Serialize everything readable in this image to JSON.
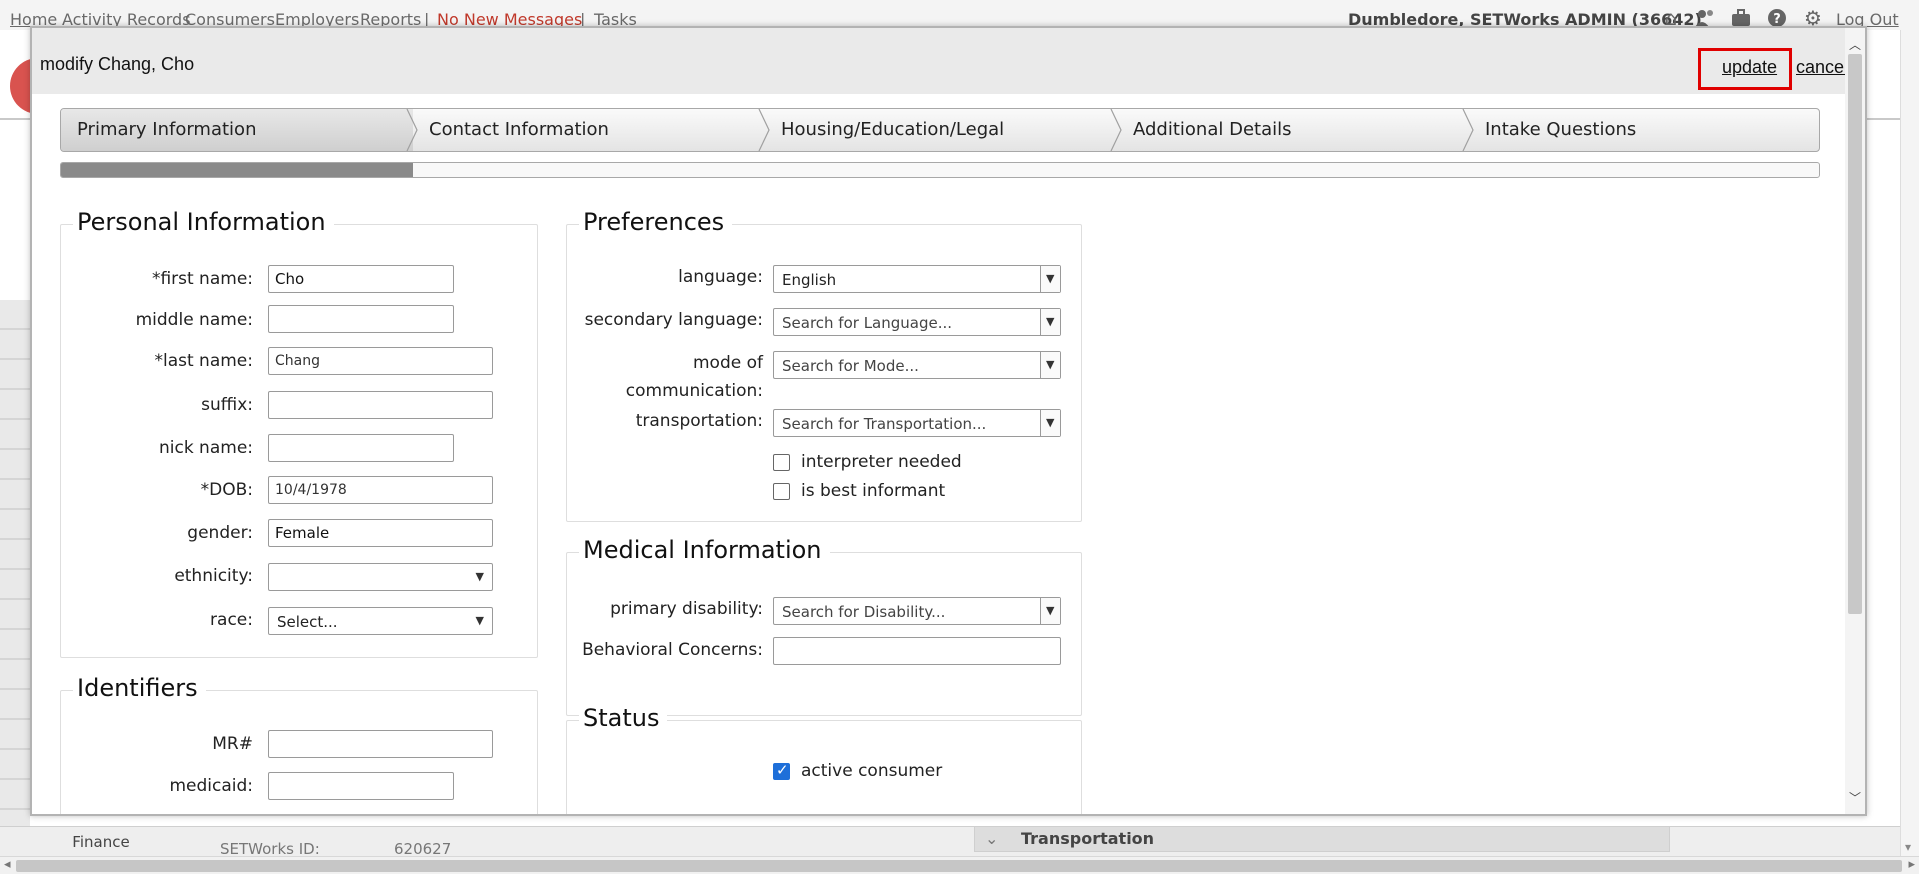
{
  "topnav": {
    "links": [
      "Home",
      "Activity Records",
      "Consumers",
      "Employers",
      "Reports"
    ],
    "messages": "No New Messages",
    "tasks": "Tasks",
    "user": "Dumbledore, SETWorks ADMIN (36642)",
    "logout": "Log Out",
    "icons": [
      "home-icon",
      "users-icon",
      "briefcase-icon",
      "help-icon",
      "gear-icon"
    ]
  },
  "background": {
    "finance": "Finance",
    "setworks_id_label": "SETWorks ID:",
    "setworks_id_value": "620627",
    "transportation": "Transportation"
  },
  "modal": {
    "title": "modify Chang, Cho",
    "update": "update",
    "cancel": "cancel",
    "steps": [
      "Primary Information",
      "Contact Information",
      "Housing/Education/Legal",
      "Additional Details",
      "Intake Questions"
    ],
    "progress_fraction": 0.2
  },
  "personal": {
    "legend": "Personal Information",
    "first_name_label": "*first name:",
    "first_name": "Cho",
    "middle_name_label": "middle name:",
    "middle_name": "",
    "last_name_label": "*last name:",
    "last_name": "Chang",
    "suffix_label": "suffix:",
    "suffix": "",
    "nick_name_label": "nick name:",
    "nick_name": "",
    "dob_label": "*DOB:",
    "dob": "10/4/1978",
    "gender_label": "gender:",
    "gender": "Female",
    "ethnicity_label": "ethnicity:",
    "ethnicity": "",
    "race_label": "race:",
    "race": "Select..."
  },
  "identifiers": {
    "legend": "Identifiers",
    "mr_label": "MR#",
    "mr": "",
    "medicaid_label": "medicaid:",
    "medicaid": ""
  },
  "preferences": {
    "legend": "Preferences",
    "language_label": "language:",
    "language": "English",
    "secondary_language_label": "secondary language:",
    "secondary_language_placeholder": "Search for Language...",
    "mode_label_1": "mode of",
    "mode_label_2": "communication:",
    "mode_placeholder": "Search for Mode...",
    "transportation_label": "transportation:",
    "transportation_placeholder": "Search for Transportation...",
    "interpreter_needed": "interpreter needed",
    "interpreter_needed_checked": false,
    "best_informant": "is best informant",
    "best_informant_checked": false
  },
  "medical": {
    "legend": "Medical Information",
    "primary_disability_label": "primary disability:",
    "primary_disability_placeholder": "Search for Disability...",
    "behavioral_label": "Behavioral Concerns:",
    "behavioral": ""
  },
  "status": {
    "legend": "Status",
    "active_consumer": "active consumer",
    "active_consumer_checked": true
  }
}
